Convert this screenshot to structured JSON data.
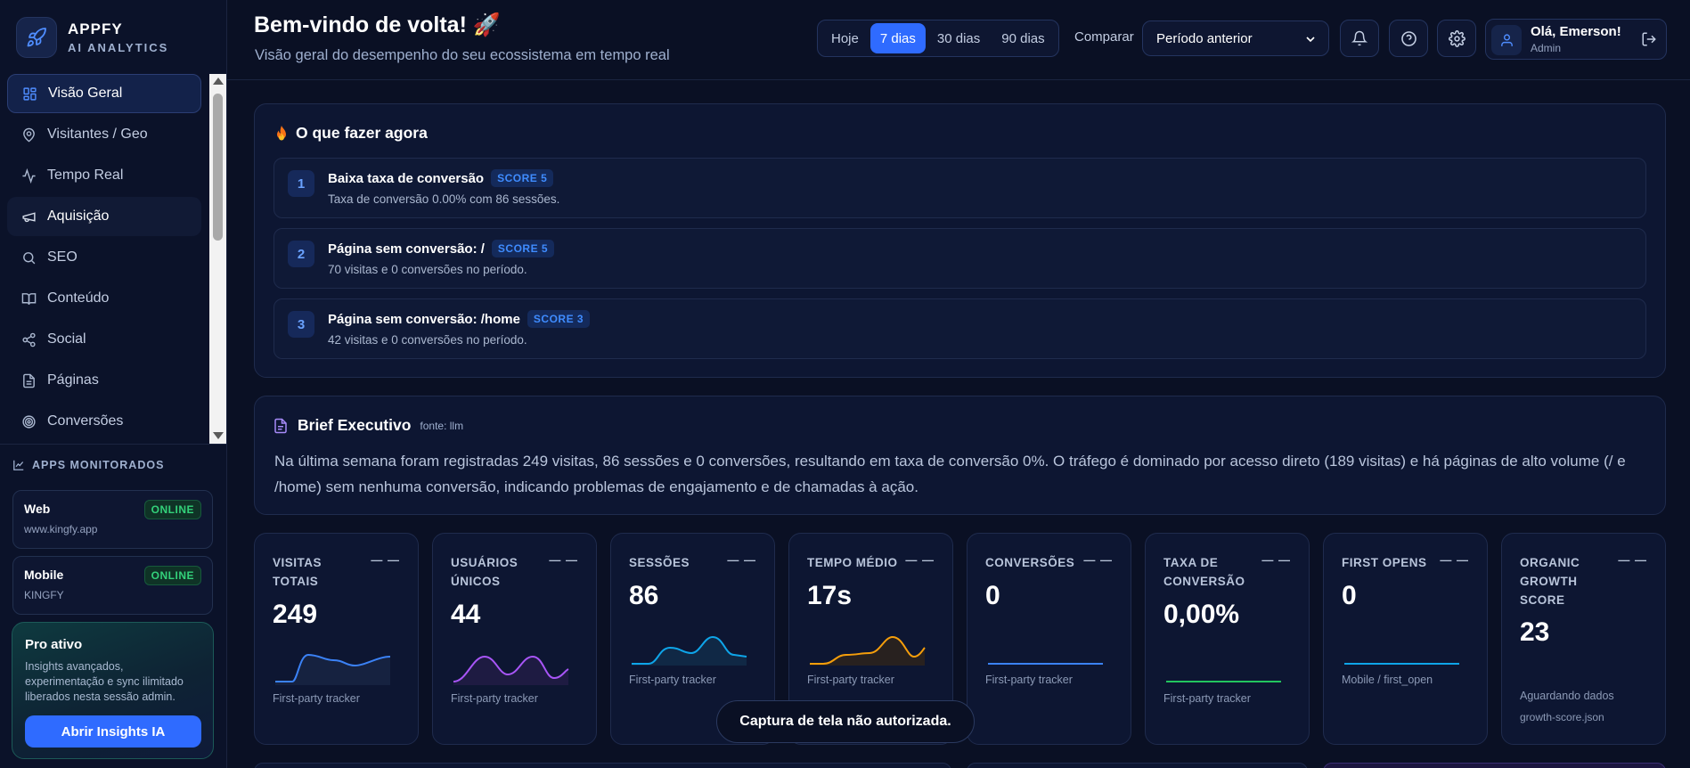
{
  "brand": {
    "name": "APPFY",
    "sub": "AI ANALYTICS"
  },
  "nav": {
    "items": [
      {
        "label": "Visão Geral",
        "icon": "dashboard-icon"
      },
      {
        "label": "Visitantes / Geo",
        "icon": "map-pin-icon"
      },
      {
        "label": "Tempo Real",
        "icon": "activity-icon"
      },
      {
        "label": "Aquisição",
        "icon": "megaphone-icon"
      },
      {
        "label": "SEO",
        "icon": "search-icon"
      },
      {
        "label": "Conteúdo",
        "icon": "book-icon"
      },
      {
        "label": "Social",
        "icon": "share-icon"
      },
      {
        "label": "Páginas",
        "icon": "file-icon"
      },
      {
        "label": "Conversões",
        "icon": "target-icon"
      }
    ]
  },
  "apps": {
    "title": "APPS MONITORADOS",
    "items": [
      {
        "name": "Web",
        "url": "www.kingfy.app",
        "status": "ONLINE"
      },
      {
        "name": "Mobile",
        "url": "KINGFY",
        "status": "ONLINE"
      }
    ]
  },
  "pro": {
    "title": "Pro ativo",
    "desc": "Insights avançados, experimentação e sync ilimitado liberados nesta sessão admin.",
    "button": "Abrir Insights IA"
  },
  "header": {
    "title": "Bem-vindo de volta! 🚀",
    "subtitle": "Visão geral do desempenho do seu ecossistema em tempo real",
    "ranges": [
      "Hoje",
      "7 dias",
      "30 dias",
      "90 dias"
    ],
    "active_range": "7 dias",
    "compare_label": "Comparar",
    "compare_value": "Período anterior",
    "user_name": "Olá, Emerson!",
    "user_role": "Admin"
  },
  "actions": {
    "title": "O que fazer agora",
    "items": [
      {
        "num": "1",
        "title": "Baixa taxa de conversão",
        "score": "SCORE 5",
        "desc": "Taxa de conversão 0.00% com 86 sessões."
      },
      {
        "num": "2",
        "title": "Página sem conversão: /",
        "score": "SCORE 5",
        "desc": "70 visitas e 0 conversões no período."
      },
      {
        "num": "3",
        "title": "Página sem conversão: /home",
        "score": "SCORE 3",
        "desc": "42 visitas e 0 conversões no período."
      }
    ]
  },
  "brief": {
    "title": "Brief Executivo",
    "source": "fonte: llm",
    "text": "Na última semana foram registradas 249 visitas, 86 sessões e 0 conversões, resultando em taxa de conversão 0%. O tráfego é dominado por acesso direto (189 visitas) e há páginas de alto volume (/ e /home) sem nenhuma conversão, indicando problemas de engajamento e de chamadas à ação."
  },
  "kpis": [
    {
      "label": "VISITAS TOTAIS",
      "trend": "— —",
      "value": "249",
      "source": "First-party tracker",
      "color": "#3b82f6"
    },
    {
      "label": "USUÁRIOS ÚNICOS",
      "trend": "— —",
      "value": "44",
      "source": "First-party tracker",
      "color": "#a855f7"
    },
    {
      "label": "SESSÕES",
      "trend": "— —",
      "value": "86",
      "source": "First-party tracker",
      "color": "#0ea5e9"
    },
    {
      "label": "TEMPO MÉDIO",
      "trend": "— —",
      "value": "17s",
      "source": "First-party tracker",
      "color": "#f59e0b"
    },
    {
      "label": "CONVERSÕES",
      "trend": "— —",
      "value": "0",
      "source": "First-party tracker",
      "color": "#3b82f6"
    },
    {
      "label": "TAXA DE CONVERSÃO",
      "trend": "— —",
      "value": "0,00%",
      "source": "First-party tracker",
      "color": "#22c55e"
    },
    {
      "label": "FIRST OPENS",
      "trend": "— —",
      "value": "0",
      "source": "Mobile / first_open",
      "color": "#0ea5e9"
    },
    {
      "label": "ORGANIC GROWTH SCORE",
      "trend": "— —",
      "value": "23",
      "source": "Aguardando dados",
      "source2": "growth-score.json"
    }
  ],
  "toast": "Captura de tela não autorizada."
}
